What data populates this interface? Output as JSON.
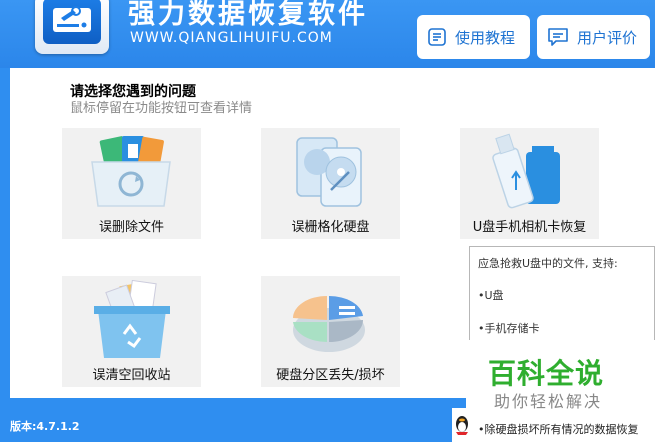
{
  "header": {
    "title": "强力数据恢复软件",
    "url": "WWW.QIANGLIHUIFU.COM",
    "tutorial_label": "使用教程",
    "review_label": "用户评价",
    "logo_icon": "hard-drive-wrench-icon",
    "colors": {
      "header_blue": "#2b86ea",
      "button_text": "#1e73d2"
    }
  },
  "prompt": {
    "title": "请选择您遇到的问题",
    "subtitle": "鼠标停留在功能按钮可查看详情"
  },
  "cards": [
    {
      "label": "误删除文件",
      "icon": "deleted-files-folder-icon"
    },
    {
      "label": "误栅格化硬盘",
      "icon": "hard-drives-icon"
    },
    {
      "label": "U盘手机相机卡恢复",
      "icon": "usb-sd-card-icon"
    },
    {
      "label": "误清空回收站",
      "icon": "recycle-bin-icon"
    },
    {
      "label": "硬盘分区丢失/损坏",
      "icon": "partition-pie-icon"
    }
  ],
  "tooltip": {
    "intro": "应急抢救U盘中的文件, 支持:",
    "item_usb": "•U盘",
    "item_phone": "•手机存储卡",
    "item_all": "•除硬盘损坏所有情况的数据恢复"
  },
  "watermark": {
    "main": "百科全说",
    "sub": "助你轻松解决"
  },
  "footer": {
    "version": "版本:4.7.1.2"
  }
}
